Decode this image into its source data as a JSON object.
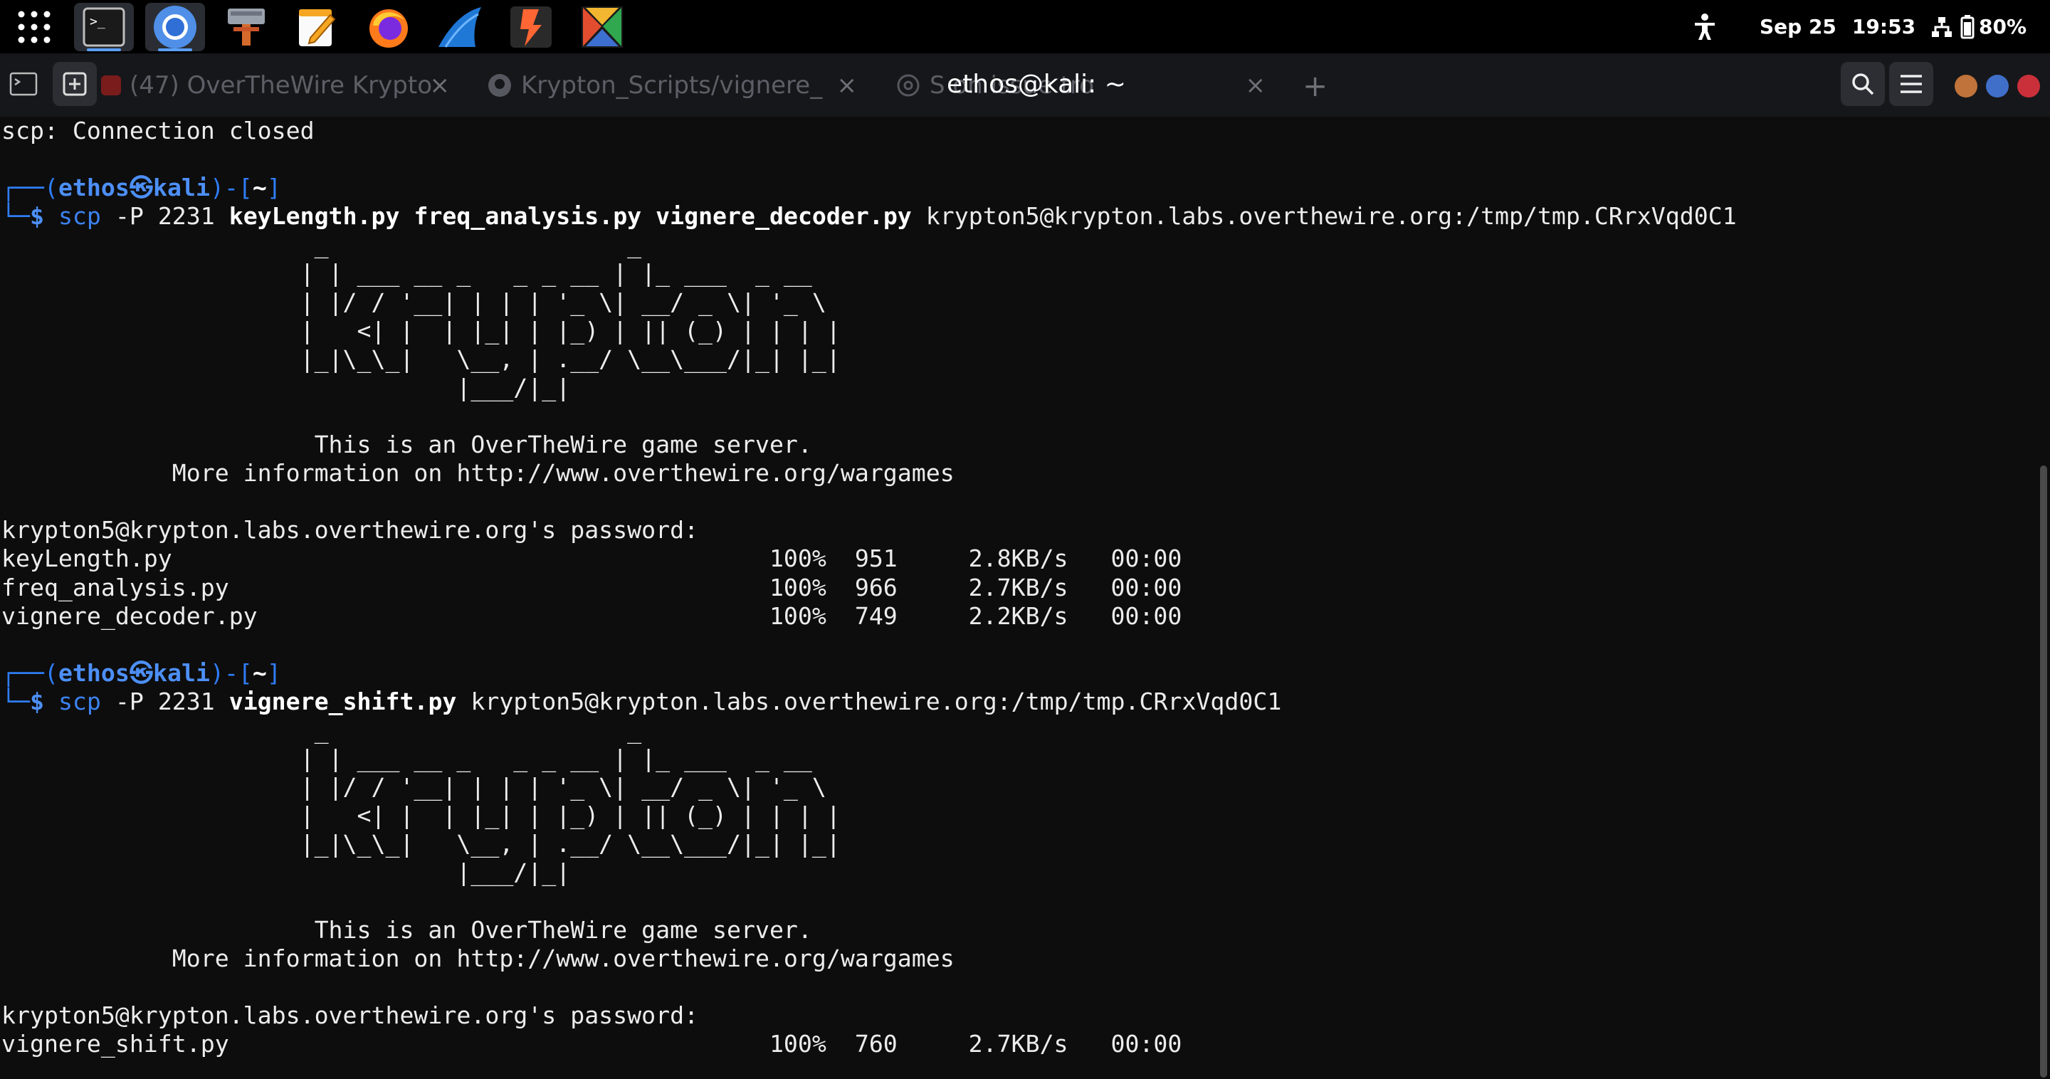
{
  "topbar": {
    "apps": [
      "apps-grid",
      "terminal",
      "chromium",
      "settings-tool",
      "text-editor",
      "firefox",
      "wireshark",
      "burpsuite",
      "maltego"
    ],
    "date": "Sep 25",
    "time": "19:53",
    "battery": "80%"
  },
  "header": {
    "window_title": "ethos@kali: ~",
    "tabs": [
      {
        "label": "(47) OverTheWire Krypto"
      },
      {
        "label": "Krypton_Scripts/vignere_"
      },
      {
        "label": "S                    on issue tro"
      }
    ],
    "new_tab": "+",
    "close_glyph": "×"
  },
  "terminal": {
    "line_closed": "scp: Connection closed",
    "prompt": {
      "open": "┌──(",
      "user": "ethos",
      "at": "㉿",
      "host": "kali",
      "close": ")-[",
      "dir": "~",
      "end": "]",
      "line2": "└─",
      "dollar": "$"
    },
    "cmd1": {
      "exe": "scp",
      "flag": " -P 2231 ",
      "files": "keyLength.py freq_analysis.py vignere_decoder.py",
      "dest": " krypton5@krypton.labs.overthewire.org:/tmp/tmp.CRrxVqd0C1"
    },
    "banner": [
      "                      _                     _",
      "                     | | ___ __ _   _ _ __ | |_ ___  _ __",
      "                     | |/ / '__| | | | '_ \\| __/ _ \\| '_ \\",
      "                     |   <| |  | |_| | |_) | || (_) | | | |",
      "                     |_|\\_\\_|   \\__, | .__/ \\__\\___/|_| |_|",
      "                                |___/|_|",
      "",
      "                      This is an OverTheWire game server.",
      "            More information on http://www.overthewire.org/wargames"
    ],
    "password_prompt": "krypton5@krypton.labs.overthewire.org's password:",
    "transfers1": [
      {
        "file": "keyLength.py",
        "pct": "100%",
        "size": "951",
        "rate": "2.8KB/s",
        "time": "00:00"
      },
      {
        "file": "freq_analysis.py",
        "pct": "100%",
        "size": "966",
        "rate": "2.7KB/s",
        "time": "00:00"
      },
      {
        "file": "vignere_decoder.py",
        "pct": "100%",
        "size": "749",
        "rate": "2.2KB/s",
        "time": "00:00"
      }
    ],
    "cmd2": {
      "exe": "scp",
      "flag": " -P 2231 ",
      "files": "vignere_shift.py",
      "dest": " krypton5@krypton.labs.overthewire.org:/tmp/tmp.CRrxVqd0C1"
    },
    "transfers2": [
      {
        "file": "vignere_shift.py",
        "pct": "100%",
        "size": "760",
        "rate": "2.7KB/s",
        "time": "00:00"
      }
    ]
  }
}
